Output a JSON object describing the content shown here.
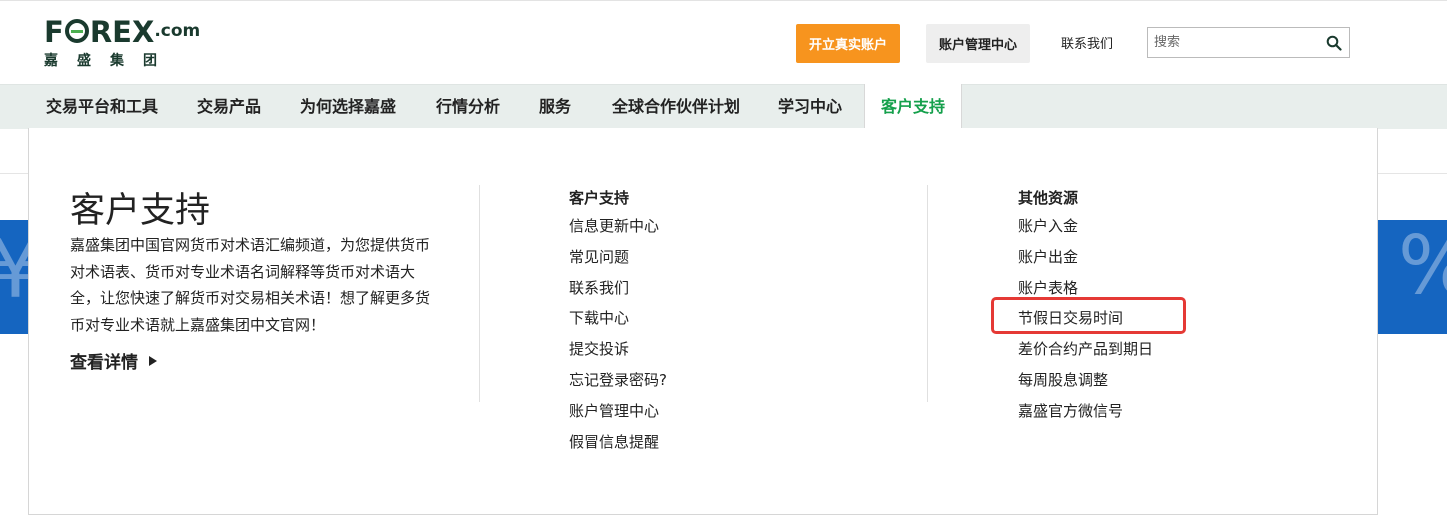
{
  "header": {
    "logo_text_left": "F",
    "logo_text_right": "REX",
    "logo_suffix": ".com",
    "logo_cn": "嘉盛集团",
    "open_account_label": "开立真实账户",
    "account_center_label": "账户管理中心",
    "contact_label": "联系我们",
    "search_placeholder": "搜索",
    "search_icon": "search-icon"
  },
  "nav": {
    "items": [
      {
        "label": "交易平台和工具"
      },
      {
        "label": "交易产品"
      },
      {
        "label": "为何选择嘉盛"
      },
      {
        "label": "行情分析"
      },
      {
        "label": "服务"
      },
      {
        "label": "全球合作伙伴计划"
      },
      {
        "label": "学习中心"
      },
      {
        "label": "客户支持"
      }
    ],
    "active_index": 7
  },
  "dropdown": {
    "intro": {
      "title": "客户支持",
      "description": "嘉盛集团中国官网货币对术语汇编频道，为您提供货币对术语表、货币对专业术语名词解释等货币对术语大全，让您快速了解货币对交易相关术语！想了解更多货币对专业术语就上嘉盛集团中文官网！",
      "more_label": "查看详情"
    },
    "columns": [
      {
        "heading": "客户支持",
        "links": [
          "信息更新中心",
          "常见问题",
          "联系我们",
          "下载中心",
          "提交投诉",
          "忘记登录密码?",
          "账户管理中心",
          "假冒信息提醒"
        ]
      },
      {
        "heading": "其他资源",
        "links": [
          "账户入金",
          "账户出金",
          "账户表格",
          "节假日交易时间",
          "差价合约产品到期日",
          "每周股息调整",
          "嘉盛官方微信号"
        ]
      }
    ]
  },
  "colors": {
    "brand_dark": "#1a3a2e",
    "accent_orange": "#f7941e",
    "active_green": "#15a04c",
    "nav_bg": "#e8eeec",
    "banner_blue": "#1565c0",
    "highlight_red": "#e53935"
  }
}
